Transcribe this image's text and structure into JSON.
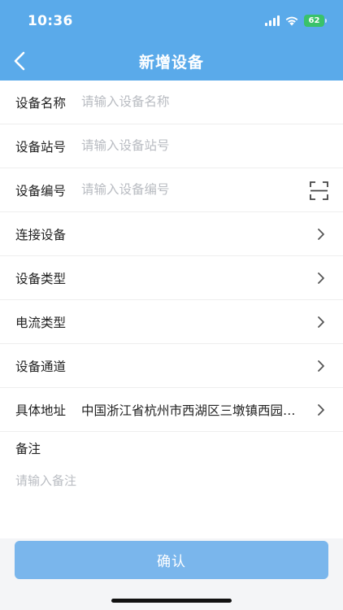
{
  "status_bar": {
    "time": "10:36",
    "battery": "62",
    "signal_icon": "cellular-signal-icon",
    "wifi_icon": "wifi-icon"
  },
  "header": {
    "title": "新增设备",
    "back_icon": "chevron-left-icon",
    "color": "#5aaaea"
  },
  "form": {
    "device_name": {
      "label": "设备名称",
      "placeholder": "请输入设备名称",
      "value": ""
    },
    "device_station": {
      "label": "设备站号",
      "placeholder": "请输入设备站号",
      "value": ""
    },
    "device_code": {
      "label": "设备编号",
      "placeholder": "请输入设备编号",
      "value": "",
      "icon": "scan-icon"
    },
    "connect_device": {
      "label": "连接设备",
      "value": ""
    },
    "device_type": {
      "label": "设备类型",
      "value": ""
    },
    "current_type": {
      "label": "电流类型",
      "value": ""
    },
    "device_channel": {
      "label": "设备通道",
      "value": ""
    },
    "address": {
      "label": "具体地址",
      "value": "中国浙江省杭州市西湖区三墩镇西园…"
    },
    "remark": {
      "label": "备注",
      "placeholder": "请输入备注",
      "value": ""
    }
  },
  "confirm_button": {
    "label": "确认",
    "color": "#7ab6ec"
  }
}
